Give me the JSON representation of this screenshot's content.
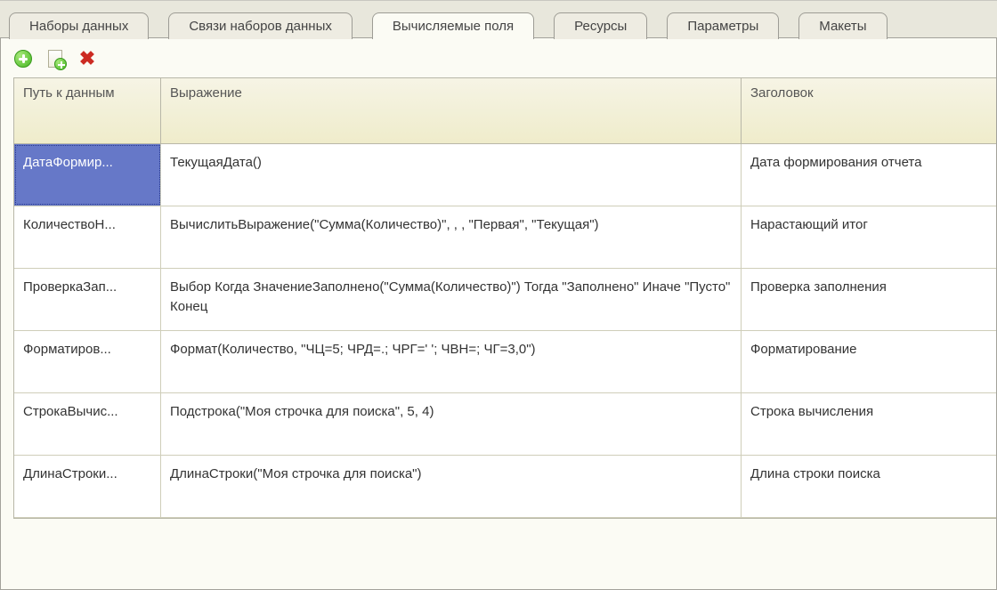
{
  "tabs": [
    {
      "label": "Наборы данных",
      "active": false
    },
    {
      "label": "Связи наборов данных",
      "active": false
    },
    {
      "label": "Вычисляемые поля",
      "active": true
    },
    {
      "label": "Ресурсы",
      "active": false
    },
    {
      "label": "Параметры",
      "active": false
    },
    {
      "label": "Макеты",
      "active": false
    }
  ],
  "toolbar": {
    "add": "add-icon",
    "add_doc": "add-document-icon",
    "delete": "delete-icon"
  },
  "grid": {
    "columns": {
      "path": "Путь к данным",
      "expr": "Выражение",
      "title": "Заголовок"
    },
    "rows": [
      {
        "path": "ДатаФормир...",
        "expr": "ТекущаяДата()",
        "title": "Дата формирования отчета",
        "selected": true
      },
      {
        "path": "КоличествоН...",
        "expr": "ВычислитьВыражение(\"Сумма(Количество)\", , , \"Первая\", \"Текущая\")",
        "title": "Нарастающий итог",
        "selected": false
      },
      {
        "path": "ПроверкаЗап...",
        "expr": "Выбор Когда ЗначениеЗаполнено(\"Сумма(Количество)\") Тогда \"Заполнено\" Иначе \"Пусто\" Конец",
        "title": "Проверка заполнения",
        "selected": false
      },
      {
        "path": "Форматиров...",
        "expr": "Формат(Количество, \"ЧЦ=5; ЧРД=.; ЧРГ=' '; ЧВН=; ЧГ=3,0\")",
        "title": "Форматирование",
        "selected": false
      },
      {
        "path": "СтрокаВычис...",
        "expr": "Подстрока(\"Моя строчка для поиска\", 5, 4)",
        "title": "Строка вычисления",
        "selected": false
      },
      {
        "path": "ДлинаСтроки...",
        "expr": "ДлинаСтроки(\"Моя строчка для поиска\")",
        "title": "Длина строки поиска",
        "selected": false
      }
    ]
  }
}
